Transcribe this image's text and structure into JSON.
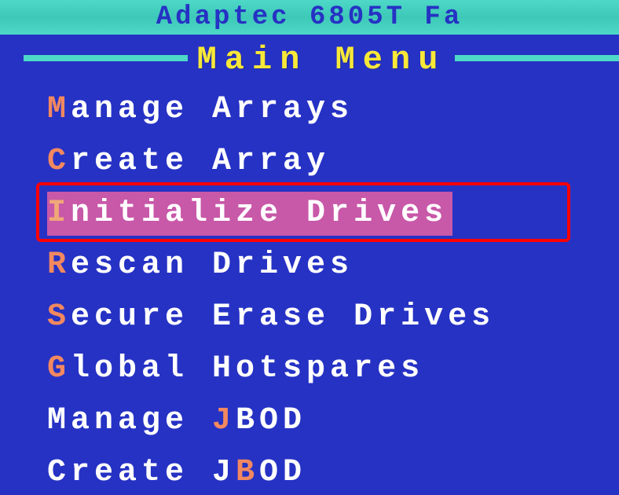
{
  "header": {
    "title": "Adaptec 6805T Fa"
  },
  "menu": {
    "title": "Main Menu",
    "items": [
      {
        "hotkey": "M",
        "text": "anage Arrays",
        "selected": false
      },
      {
        "hotkey": "C",
        "text": "reate Array",
        "selected": false
      },
      {
        "hotkey": "I",
        "text": "nitialize Drives",
        "selected": true
      },
      {
        "hotkey": "R",
        "text": "escan Drives",
        "selected": false
      },
      {
        "hotkey": "S",
        "text": "ecure Erase Drives",
        "selected": false
      },
      {
        "hotkey": "G",
        "text": "lobal Hotspares",
        "selected": false
      },
      {
        "pre": "Manage ",
        "hotkey": "J",
        "text": "BOD",
        "selected": false
      },
      {
        "pre": "Create J",
        "hotkey": "B",
        "text": "OD",
        "selected": false
      }
    ]
  }
}
